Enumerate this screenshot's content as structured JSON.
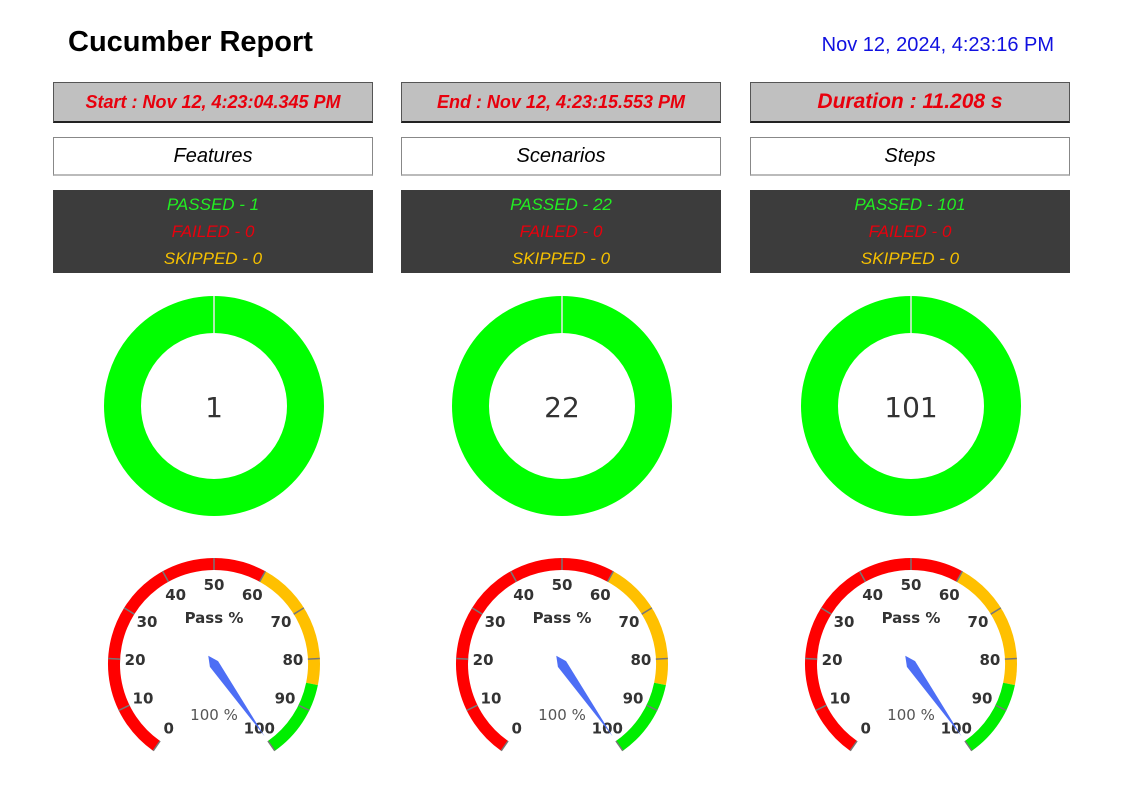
{
  "header": {
    "title": "Cucumber Report",
    "timestamp": "Nov 12, 2024, 4:23:16 PM"
  },
  "columns": [
    {
      "top_label": "Start : Nov 12, 4:23:04.345 PM",
      "category": "Features",
      "passed": "PASSED - 1",
      "failed": "FAILED - 0",
      "skipped": "SKIPPED - 0",
      "donut_center": "1",
      "donut": {
        "passed": 1,
        "failed": 0,
        "skipped": 0
      },
      "gauge": {
        "title": "Pass %",
        "value_label": "100 %",
        "value": 100
      }
    },
    {
      "top_label": "End : Nov 12, 4:23:15.553 PM",
      "category": "Scenarios",
      "passed": "PASSED - 22",
      "failed": "FAILED - 0",
      "skipped": "SKIPPED - 0",
      "donut_center": "22",
      "donut": {
        "passed": 22,
        "failed": 0,
        "skipped": 0
      },
      "gauge": {
        "title": "Pass %",
        "value_label": "100 %",
        "value": 100
      }
    },
    {
      "top_label": "Duration : 11.208 s",
      "category": "Steps",
      "passed": "PASSED - 101",
      "failed": "FAILED - 0",
      "skipped": "SKIPPED - 0",
      "donut_center": "101",
      "donut": {
        "passed": 101,
        "failed": 0,
        "skipped": 0
      },
      "gauge": {
        "title": "Pass %",
        "value_label": "100 %",
        "value": 100
      }
    }
  ],
  "gauge_ticks": [
    "0",
    "10",
    "20",
    "30",
    "40",
    "50",
    "60",
    "70",
    "80",
    "90",
    "100"
  ],
  "gauge_bands": [
    {
      "from": 0,
      "to": 60,
      "color": "#ff0000"
    },
    {
      "from": 60,
      "to": 85,
      "color": "#ffc000"
    },
    {
      "from": 85,
      "to": 100,
      "color": "#00ee00"
    }
  ],
  "colors": {
    "passed": "#00ff00",
    "failed": "#ff0000",
    "skipped": "#ffc000",
    "needle": "#4d6ef5"
  }
}
